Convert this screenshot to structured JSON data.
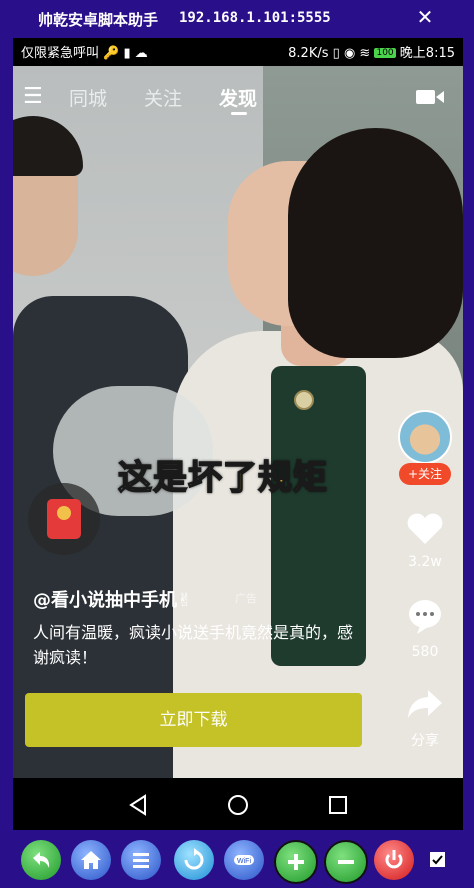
{
  "window": {
    "title": "帅乾安卓脚本助手",
    "address": "192.168.1.101:5555",
    "close_glyph": "✕"
  },
  "statusbar": {
    "left_text": "仅限紧急呼叫",
    "speed": "8.2K/s",
    "battery": "100",
    "time": "晚上8:15"
  },
  "tabs": {
    "menu_glyph": "☰",
    "items": [
      {
        "label": "同城",
        "active": false
      },
      {
        "label": "关注",
        "active": false
      },
      {
        "label": "发现",
        "active": true
      }
    ]
  },
  "video": {
    "caption_plain": "这是",
    "caption_highlight": "坏了规矩"
  },
  "sidebar": {
    "follow_label": "+关注",
    "like_count": "3.2w",
    "comment_count": "580",
    "share_label": "分享"
  },
  "post": {
    "username": "@看小说抽中手机✌",
    "ad_tag": "广告",
    "description": "人间有温暖，疯读小说送手机竟然是真的，感谢疯读！",
    "cta_label": "立即下载"
  },
  "colors": {
    "frame": "#2a0f8a",
    "cta": "#c4c226",
    "follow": "#f14a2a",
    "caption_highlight": "#f4cf3a"
  },
  "toolbar": {
    "icons": [
      "back-icon",
      "home-icon",
      "menu-icon",
      "refresh-icon",
      "wifi-icon",
      "zoom-in-icon",
      "zoom-out-icon",
      "power-icon"
    ]
  }
}
